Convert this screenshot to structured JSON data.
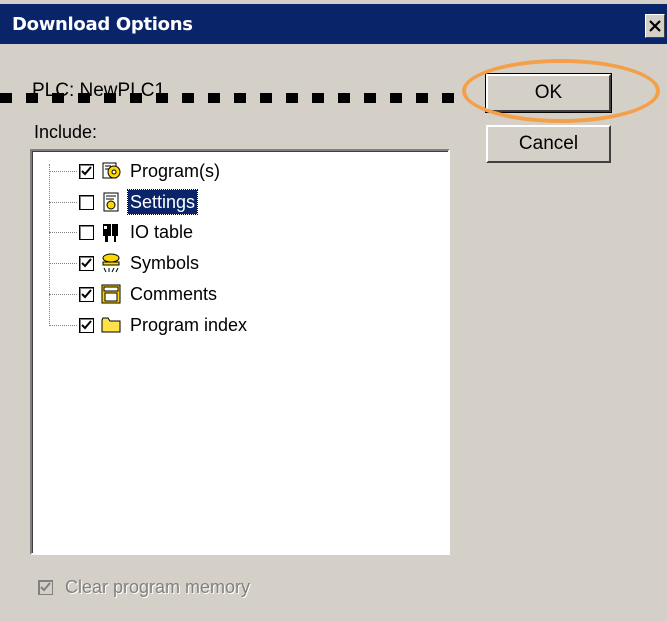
{
  "window": {
    "title": "Download Options",
    "close_label": "×"
  },
  "plc": {
    "label": "PLC:  NewPLC1"
  },
  "include": {
    "label": "Include:"
  },
  "buttons": {
    "ok_label": "OK",
    "cancel_label": "Cancel"
  },
  "tree": {
    "items": [
      {
        "label": "Program(s)",
        "checked": true,
        "icon": "program-icon"
      },
      {
        "label": "Settings",
        "checked": false,
        "icon": "settings-icon",
        "selected": true
      },
      {
        "label": "IO table",
        "checked": false,
        "icon": "io-table-icon"
      },
      {
        "label": "Symbols",
        "checked": true,
        "icon": "symbols-icon"
      },
      {
        "label": "Comments",
        "checked": true,
        "icon": "comments-icon"
      },
      {
        "label": "Program index",
        "checked": true,
        "icon": "folder-icon"
      }
    ]
  },
  "options": {
    "clear_memory_label": "Clear program memory",
    "clear_memory_checked": true,
    "clear_memory_disabled": true
  },
  "colors": {
    "titlebar": "#0a246a",
    "dialog_bg": "#d4d0c8",
    "highlight_ring": "#f4a04a"
  }
}
